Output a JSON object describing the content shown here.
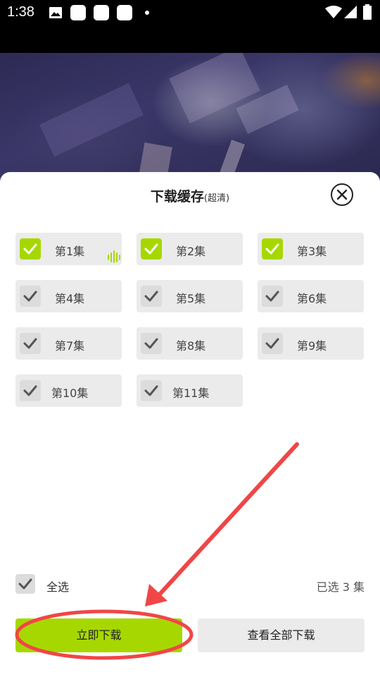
{
  "status_bar": {
    "time": "1:38",
    "icons": [
      "image-icon",
      "app-icon",
      "app-icon",
      "app-icon",
      "dot-icon",
      "wifi-icon",
      "signal-icon",
      "battery-icon"
    ]
  },
  "sheet": {
    "title": "下载缓存",
    "quality": "(超清)",
    "episodes": [
      {
        "label": "第1集",
        "checked": true,
        "playing": true
      },
      {
        "label": "第2集",
        "checked": true
      },
      {
        "label": "第3集",
        "checked": true
      },
      {
        "label": "第4集",
        "checked": false
      },
      {
        "label": "第5集",
        "checked": false
      },
      {
        "label": "第6集",
        "checked": false
      },
      {
        "label": "第7集",
        "checked": false
      },
      {
        "label": "第8集",
        "checked": false
      },
      {
        "label": "第9集",
        "checked": false
      },
      {
        "label": "第10集",
        "checked": false
      },
      {
        "label": "第11集",
        "checked": false
      }
    ],
    "select_all_label": "全选",
    "selected_count": "已选 3 集",
    "download_button": "立即下载",
    "view_all_button": "查看全部下载"
  },
  "colors": {
    "accent": "#a6d800",
    "annotation": "#f04646"
  }
}
